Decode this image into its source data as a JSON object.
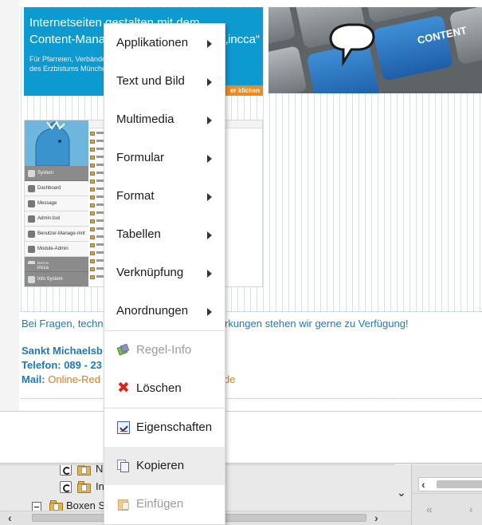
{
  "banner": {
    "line1": "Internetseiten gestalten mit dem",
    "line2": "Content-Management",
    "line2_tail": "„incca“",
    "sub1": "Für Pfarreien, Verbände",
    "sub2": "des Erzbistums Münche",
    "cta": "er klicken"
  },
  "keyboard": {
    "key_label": "CONTENT"
  },
  "cms_screenshot": {
    "nav_items": [
      "System",
      "Dashboard",
      "Message",
      "Admin.tool",
      "Benutzer-Manage-mnt",
      "Module-Admin",
      "incca",
      "incca",
      "Info System"
    ]
  },
  "contact": {
    "question_start": "Bei Fragen, techn",
    "question_end": "rkungen stehen wir gerne zu Verfügung!",
    "org": "Sankt Michaelsb",
    "phone_label": "Telefon: 089 - 23",
    "mail_label": "Mail:",
    "mail_start": "Online-Red",
    "mail_end": "de"
  },
  "context_menu": {
    "submenus": [
      {
        "label": "Applikationen"
      },
      {
        "label": "Text und Bild"
      },
      {
        "label": "Multimedia"
      },
      {
        "label": "Formular"
      },
      {
        "label": "Format"
      },
      {
        "label": "Tabellen"
      },
      {
        "label": "Verknüpfung"
      },
      {
        "label": "Anordnungen"
      }
    ],
    "actions": [
      {
        "label": "Regel-Info",
        "icon": "rule-info-icon",
        "enabled": false
      },
      {
        "label": "Löschen",
        "icon": "delete-icon",
        "enabled": true
      },
      {
        "label": "Eigenschaften",
        "icon": "properties-icon",
        "enabled": true
      },
      {
        "label": "Kopieren",
        "icon": "copy-icon",
        "enabled": true,
        "hovered": true
      },
      {
        "label": "Einfügen",
        "icon": "paste-icon",
        "enabled": false
      }
    ]
  },
  "tree": {
    "rows": [
      {
        "label": "N"
      },
      {
        "label": "In"
      },
      {
        "label": "Boxen S"
      }
    ]
  },
  "pager": {
    "first": "«",
    "prev": "‹"
  }
}
